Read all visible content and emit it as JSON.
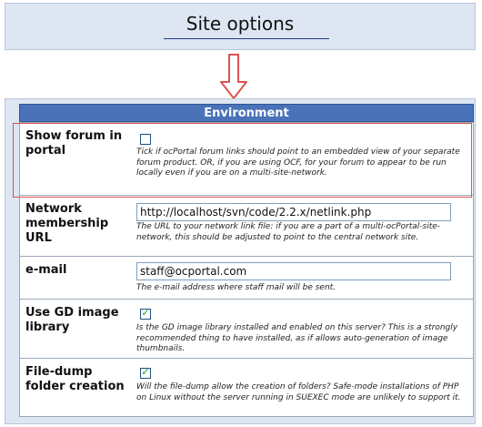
{
  "title": "Site options",
  "section_header": "Environment",
  "rows": [
    {
      "label": "Show forum in portal",
      "type": "checkbox",
      "checked": false,
      "description": "Tick if ocPortal forum links should point to an embedded view of your separate forum product. OR, if you are using OCF, for your forum to appear to be run locally even if you are on a multi-site-network."
    },
    {
      "label": "Network membership URL",
      "type": "text",
      "value": "http://localhost/svn/code/2.2.x/netlink.php",
      "description": "The URL to your network link file: if you are a part of a multi-ocPortal-site-network, this should be adjusted to point to the central network site."
    },
    {
      "label": "e-mail",
      "type": "text",
      "value": "staff@ocportal.com",
      "description": "The e-mail address where staff mail will be sent."
    },
    {
      "label": "Use GD image library",
      "type": "checkbox",
      "checked": true,
      "description": "Is the GD image library installed and enabled on this server? This is a strongly recommended thing to have installed, as if allows auto-generation of image thumbnails."
    },
    {
      "label": "File-dump folder creation",
      "type": "checkbox",
      "checked": true,
      "description": "Will the file-dump allow the creation of folders? Safe-mode installations of PHP on Linux without the server running in SUEXEC mode are unlikely to support it."
    }
  ],
  "colors": {
    "header_bg": "#4a72b8",
    "panel_bg": "#dde6f2",
    "highlight": "#d9534f",
    "arrow": "#d9534f",
    "checkmark": "#21a121"
  }
}
